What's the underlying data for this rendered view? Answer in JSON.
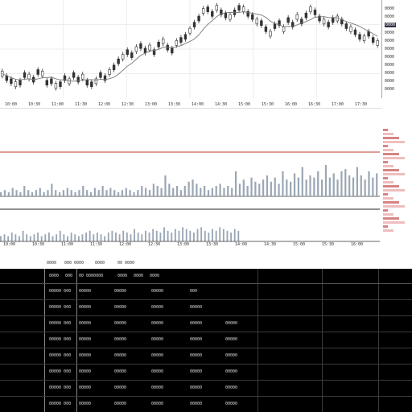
{
  "price_axis": {
    "labels": [
      "0000",
      "0000",
      "0000",
      "0000",
      "0000",
      "0000",
      "0000",
      "0000",
      "0000",
      "0000",
      "0000"
    ],
    "highlighted": "0000"
  },
  "x_axis_top": [
    "10:00",
    "10:30",
    "11:00",
    "11:30",
    "12:00",
    "12:30",
    "13:00",
    "13:30",
    "14:00",
    "14:30",
    "15:00",
    "15:30",
    "16:00",
    "16:30",
    "17:00",
    "17:30"
  ],
  "x_axis_bottom": [
    "10:00",
    "10:30",
    "11:00",
    "11:30",
    "12:00",
    "12:30",
    "13:00",
    "13:30",
    "14:00",
    "14:30",
    "15:00",
    "15:30",
    "16:00"
  ],
  "legend_row": [
    "0000",
    "000 0000",
    "0000",
    "00 0000"
  ],
  "colors": {
    "candle": "#333333",
    "ma_line": "#777777",
    "volume_bar": "#9aa6b4",
    "red_line": "#c0392b",
    "panel_bg": "#ffffff",
    "table_bg": "#000000"
  },
  "chart_data": [
    {
      "type": "line",
      "title": "",
      "xlabel": "",
      "ylabel": "",
      "series": [
        {
          "values": [
            104,
            101,
            99,
            97,
            98,
            103,
            102,
            100,
            105,
            104,
            98,
            99,
            96,
            97,
            101,
            99,
            103,
            100,
            102,
            98,
            97,
            99,
            103,
            101,
            105,
            108,
            112,
            115,
            118,
            116,
            120,
            122,
            119,
            121,
            118,
            123,
            125,
            121,
            119,
            124,
            126,
            128,
            132,
            136,
            140,
            145,
            146,
            143,
            147,
            144,
            142,
            141,
            144,
            147,
            146,
            143,
            141,
            138,
            137,
            133,
            130,
            135,
            137,
            133,
            139,
            136,
            141,
            138,
            142,
            146,
            144,
            140,
            138,
            136,
            139,
            140,
            138,
            135,
            133,
            131,
            128,
            127,
            130,
            126,
            124
          ]
        }
      ]
    },
    {
      "type": "bar",
      "title": "",
      "values": [
        2,
        3,
        2,
        4,
        3,
        2,
        5,
        3,
        2,
        3,
        4,
        2,
        3,
        6,
        3,
        2,
        3,
        4,
        3,
        2,
        3,
        5,
        3,
        2,
        4,
        3,
        5,
        3,
        4,
        3,
        2,
        3,
        4,
        3,
        2,
        3,
        5,
        4,
        3,
        6,
        5,
        4,
        10,
        6,
        4,
        5,
        3,
        5,
        7,
        8,
        6,
        4,
        5,
        3,
        4,
        5,
        6,
        4,
        5,
        4,
        12,
        6,
        8,
        5,
        9,
        7,
        6,
        8,
        10,
        7,
        9,
        6,
        12,
        8,
        7,
        11,
        9,
        14,
        8,
        10,
        9,
        12,
        8,
        15,
        9,
        11,
        8,
        12,
        13,
        10,
        9,
        14,
        10,
        8,
        12,
        9,
        11
      ]
    },
    {
      "type": "bar",
      "title": "",
      "values": [
        3,
        4,
        3,
        5,
        4,
        3,
        6,
        4,
        3,
        4,
        5,
        3,
        4,
        5,
        3,
        4,
        6,
        4,
        3,
        5,
        4,
        3,
        4,
        5,
        6,
        4,
        5,
        4,
        3,
        5,
        6,
        5,
        4,
        6,
        5,
        4,
        7,
        5,
        4,
        6,
        5,
        7,
        6,
        5,
        8,
        6,
        5,
        7,
        6,
        8,
        7,
        6,
        5,
        7,
        8,
        6,
        5,
        7,
        6,
        8,
        7,
        6,
        5,
        7,
        6
      ]
    }
  ],
  "table": {
    "header": [
      "0000",
      "000",
      "00 0000000",
      "0000",
      "0000",
      "0000"
    ],
    "rows": [
      [
        "00000 000",
        "00000",
        "00000",
        "00000",
        "000"
      ],
      [
        "00000 000",
        "00000",
        "00000",
        "00000",
        "00000"
      ],
      [
        "00000 000",
        "00000",
        "00000",
        "00000",
        "00000",
        "00000"
      ],
      [
        "00000 000",
        "00000",
        "00000",
        "00000",
        "00000",
        "00000"
      ],
      [
        "00000 000",
        "00000",
        "00000",
        "00000",
        "00000",
        "00000"
      ],
      [
        "00000 000",
        "00000",
        "00000",
        "00000",
        "00000",
        "00000"
      ],
      [
        "00000 000",
        "00000",
        "00000",
        "00000",
        "00000",
        "00000"
      ],
      [
        "00000 000",
        "00000",
        "00000",
        "00000",
        "00000",
        "00000"
      ]
    ]
  }
}
